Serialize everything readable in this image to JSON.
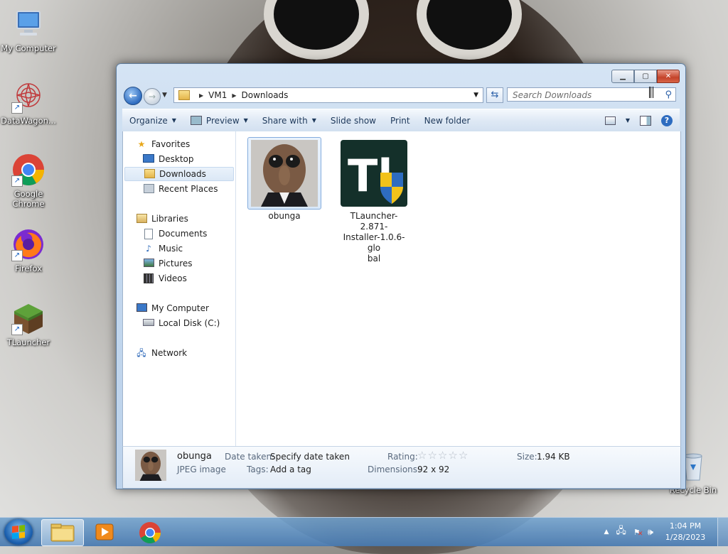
{
  "desktop": {
    "icons": [
      {
        "label": "My Computer"
      },
      {
        "label": "DataWagon..."
      },
      {
        "label": "Google Chrome"
      },
      {
        "label": "Firefox"
      },
      {
        "label": "TLauncher"
      },
      {
        "label": "Recycle Bin"
      }
    ]
  },
  "window": {
    "address": {
      "crumbs": [
        "VM1",
        "Downloads"
      ]
    },
    "search": {
      "placeholder": "Search Downloads"
    },
    "toolbar": {
      "organize": "Organize",
      "preview": "Preview",
      "share_with": "Share with",
      "slide_show": "Slide show",
      "print": "Print",
      "new_folder": "New folder"
    },
    "nav": {
      "favorites": "Favorites",
      "desktop": "Desktop",
      "downloads": "Downloads",
      "recent_places": "Recent Places",
      "libraries": "Libraries",
      "documents": "Documents",
      "music": "Music",
      "pictures": "Pictures",
      "videos": "Videos",
      "my_computer": "My Computer",
      "local_disk": "Local Disk (C:)",
      "network": "Network"
    },
    "files": [
      {
        "name": "obunga",
        "selected": true
      },
      {
        "name": "TLauncher-2.871-Installer-1.0.6-global",
        "display": [
          "TLauncher-2.871-",
          "Installer-1.0.6-glo",
          "bal"
        ]
      }
    ],
    "details": {
      "name": "obunga",
      "type": "JPEG image",
      "date_taken_label": "Date taken:",
      "date_taken_value": "Specify date taken",
      "tags_label": "Tags:",
      "tags_value": "Add a tag",
      "rating_label": "Rating:",
      "rating_stars": 0,
      "dimensions_label": "Dimensions:",
      "dimensions_value": "92 x 92",
      "size_label": "Size:",
      "size_value": "1.94 KB"
    }
  },
  "taskbar": {
    "time": "1:04 PM",
    "date": "1/28/2023"
  }
}
